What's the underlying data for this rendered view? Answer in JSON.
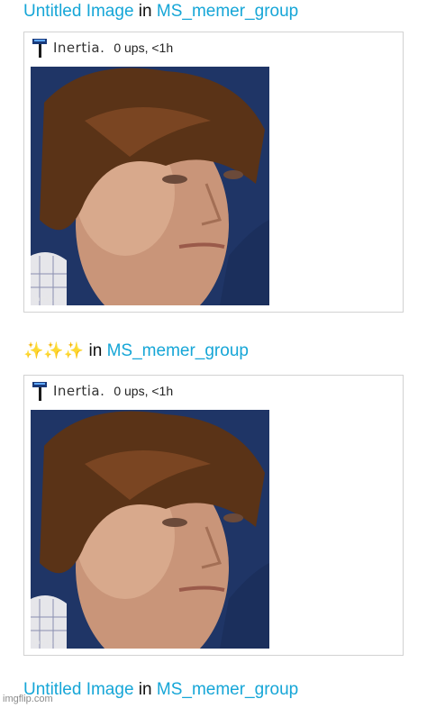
{
  "posts": [
    {
      "title": "Untitled Image",
      "separator": "in",
      "stream": "MS_memer_group",
      "author": "Inertia.",
      "meta": "0 ups, <1h",
      "image_watermark": "imgflip.com"
    },
    {
      "title": "✨✨✨",
      "separator": "in",
      "stream": "MS_memer_group",
      "author": "Inertia.",
      "meta": "0 ups, <1h",
      "image_watermark": "imgflip.com"
    },
    {
      "title": "Untitled Image",
      "separator": "in",
      "stream": "MS_memer_group"
    }
  ],
  "footer": {
    "watermark": "imgflip.com"
  },
  "icons": {
    "avatar": "hammer-avatar-icon"
  },
  "colors": {
    "link": "#16a6d7",
    "border": "#d2d2d2"
  }
}
